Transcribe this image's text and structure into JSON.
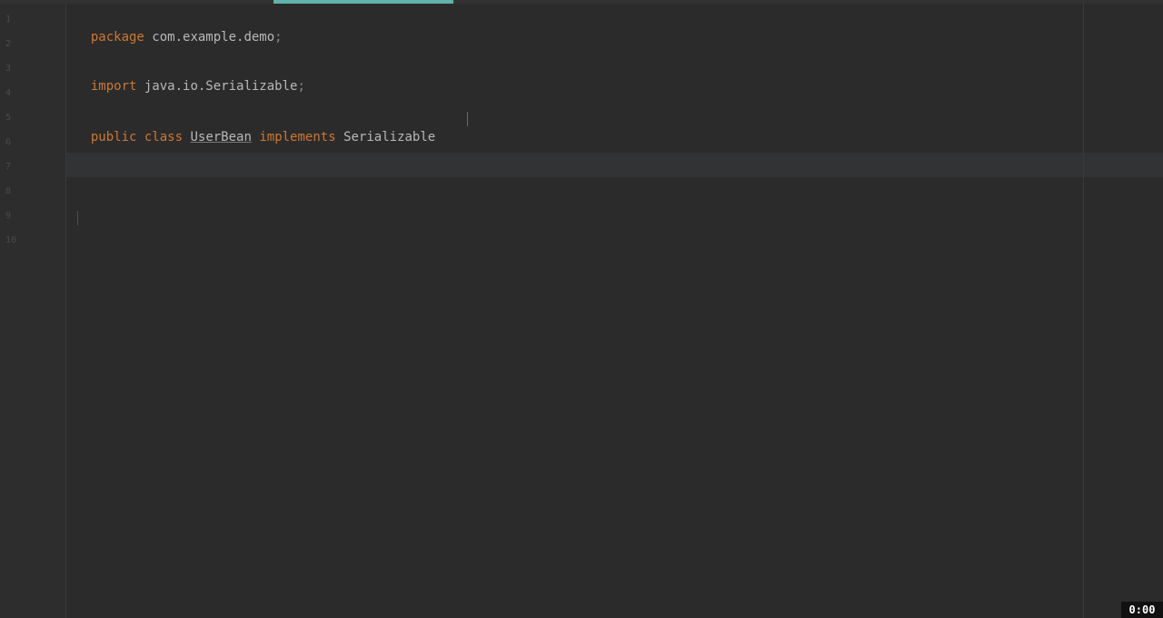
{
  "editor": {
    "line_numbers": [
      "1",
      "2",
      "3",
      "4",
      "5",
      "6",
      "7",
      "8",
      "9",
      "10"
    ],
    "lines": {
      "line1": {
        "keyword": "package",
        "text": " com.example.demo",
        "punct": ";"
      },
      "line3": {
        "keyword": "import",
        "text": " java.io.Serializable",
        "punct": ";"
      },
      "line5": {
        "kw1": "public",
        "kw2": "class",
        "class_name": "UserBean",
        "kw3": "implements",
        "iface": "Serializable"
      }
    }
  },
  "player": {
    "time": "0:00"
  },
  "colors": {
    "keyword": "#cc7832",
    "text": "#b8b8b8",
    "background": "#2b2b2b",
    "accent": "#5fb3a8"
  }
}
